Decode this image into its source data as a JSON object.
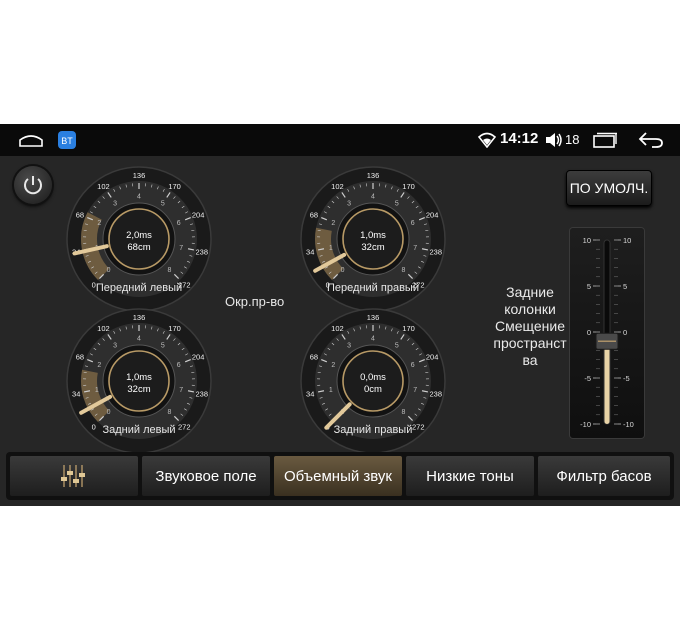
{
  "statusbar": {
    "time": "14:12",
    "volume_level": "18",
    "icons": [
      "home-icon",
      "app-badge-icon",
      "wifi-icon",
      "volume-icon",
      "recents-icon",
      "back-icon"
    ]
  },
  "top": {
    "default_button": "ПО УМОЛЧ.",
    "surround_label": "Окр.пр-во"
  },
  "gauges": [
    {
      "name": "front-left",
      "title": "Передний левый",
      "delay": "2,0ms",
      "distance": "68cm",
      "level": 0.12
    },
    {
      "name": "front-right",
      "title": "Передний правый",
      "delay": "1,0ms",
      "distance": "32cm",
      "level": 0.06
    },
    {
      "name": "rear-left",
      "title": "Задний левый",
      "delay": "1,0ms",
      "distance": "32cm",
      "level": 0.06
    },
    {
      "name": "rear-right",
      "title": "Задний правый",
      "delay": "0,0ms",
      "distance": "0cm",
      "level": 0.0
    }
  ],
  "gauge_scale": {
    "outer_ticks": [
      "0",
      "34",
      "68",
      "102",
      "136",
      "170",
      "204",
      "238",
      "272"
    ],
    "inner_ticks": [
      "0",
      "1",
      "2",
      "3",
      "4",
      "5",
      "6",
      "7",
      "8"
    ]
  },
  "rear_speakers": {
    "label_line1": "Задние",
    "label_line2": "колонки",
    "label_line3": "Смещение",
    "label_line4": "пространст",
    "label_line5": "ва",
    "scale": [
      "10",
      "5",
      "0",
      "-5",
      "-10"
    ],
    "value": -1
  },
  "tabs": [
    {
      "label": "",
      "icon": "equalizer-icon",
      "active": false
    },
    {
      "label": "Звуковое поле",
      "active": false
    },
    {
      "label": "Объемный звук",
      "active": true
    },
    {
      "label": "Низкие тоны",
      "active": false
    },
    {
      "label": "Фильтр басов",
      "active": false
    }
  ],
  "colors": {
    "accent_gold": "#c9a872",
    "background": "#262626"
  }
}
